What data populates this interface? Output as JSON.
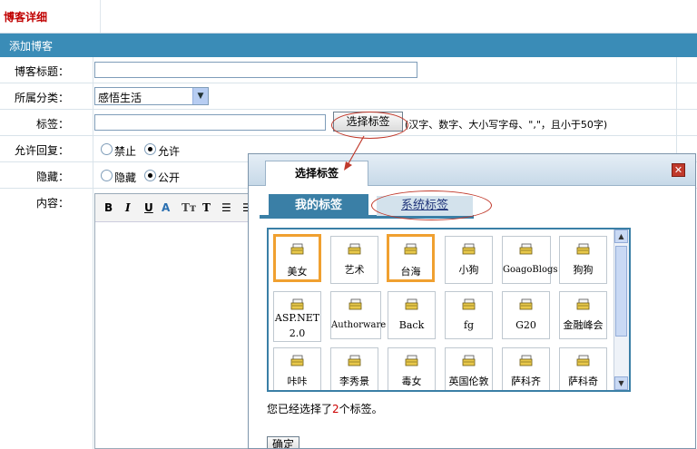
{
  "page": {
    "title": "博客详细",
    "section": "添加博客"
  },
  "form": {
    "title_label": "博客标题：",
    "category_label": "所属分类：",
    "category_value": "感悟生活",
    "tags_label": "标签：",
    "choose_tags_button": "选择标签",
    "tags_hint": "(汉字、数字、大小写字母、\",\"，且小于50字)",
    "reply_label": "允许回复：",
    "reply_options": [
      "禁止",
      "允许"
    ],
    "hidden_label": "隐藏：",
    "hidden_options": [
      "隐藏",
      "公开"
    ],
    "content_label": "内容："
  },
  "dialog": {
    "title": "选择标签",
    "close": "✕",
    "tabs": [
      "我的标签",
      "系统标签"
    ],
    "tags_row1": [
      "美女",
      "艺术",
      "台海",
      "小狗",
      "GoagoBlogs",
      "狗狗"
    ],
    "tags_row2": [
      "ASP.NET",
      "2.0",
      "Authorware",
      "Back",
      "fg",
      "G20",
      "金融峰会"
    ],
    "tags_row3": [
      "咔咔",
      "李秀景",
      "毒女",
      "英国伦敦",
      "萨科齐",
      "萨科奇"
    ],
    "status_prefix": "您已经选择了",
    "status_count": "2",
    "status_suffix": "个标签。",
    "ok_button": "确定"
  },
  "colors": {
    "header": "#3a8cb7",
    "tab_active": "#3a7fa6",
    "selected_border": "#f0a030",
    "title_red": "#c00000"
  }
}
